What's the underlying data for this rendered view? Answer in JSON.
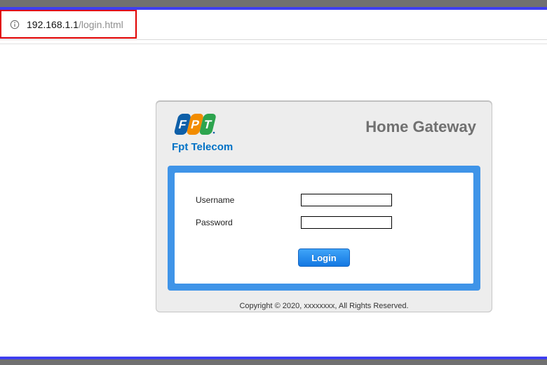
{
  "addressbar": {
    "url_host": "192.168.1.1",
    "url_path": "/login.html"
  },
  "logo": {
    "letters": [
      "F",
      "P",
      "T"
    ],
    "brand_sub": "Fpt Telecom"
  },
  "header_title": "Home Gateway",
  "form": {
    "username_label": "Username",
    "username_value": "",
    "password_label": "Password",
    "password_value": "",
    "login_label": "Login"
  },
  "footer": "Copyright © 2020, xxxxxxxx, All Rights Reserved."
}
